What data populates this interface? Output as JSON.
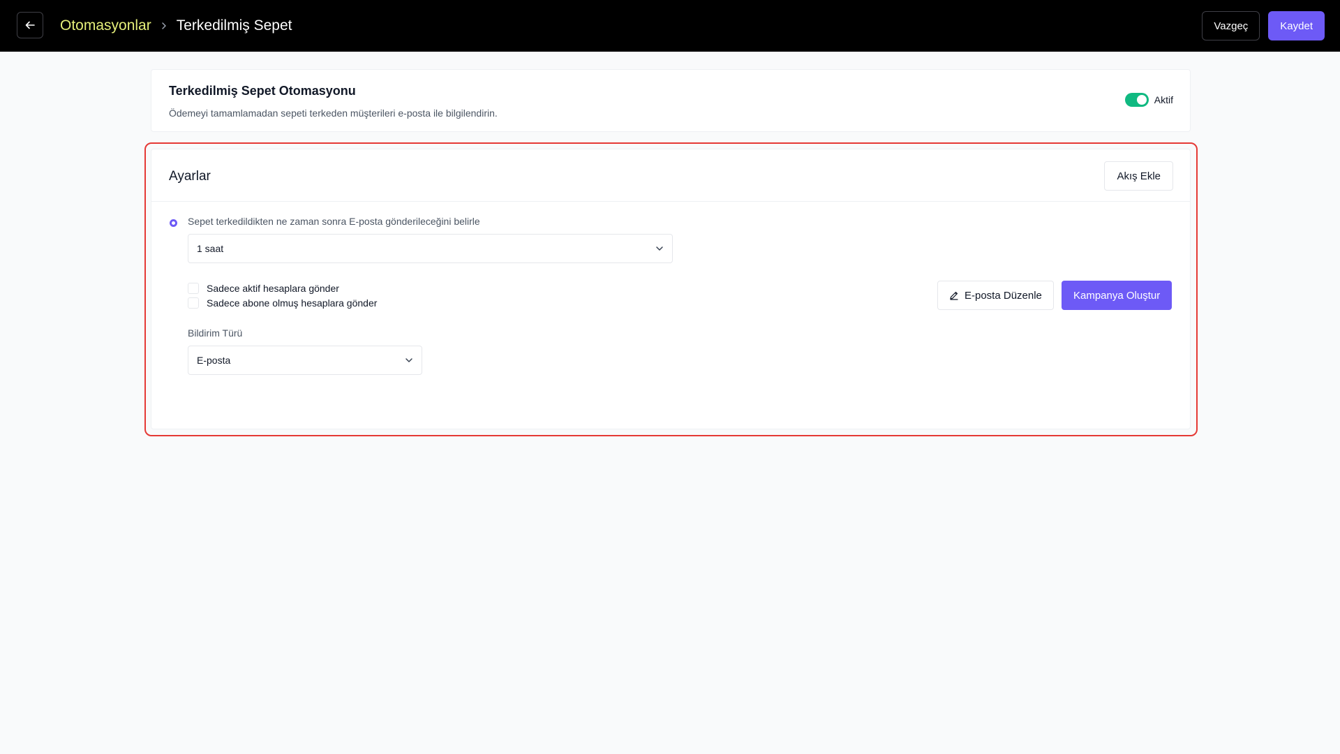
{
  "topbar": {
    "back_icon": "arrow-left-icon",
    "breadcrumb_parent": "Otomasyonlar",
    "breadcrumb_current": "Terkedilmiş Sepet",
    "cancel_label": "Vazgeç",
    "save_label": "Kaydet"
  },
  "header": {
    "title": "Terkedilmiş Sepet Otomasyonu",
    "description": "Ödemeyi tamamlamadan sepeti terkeden müşterileri e-posta ile bilgilendirin.",
    "status_label": "Aktif",
    "status_enabled": true
  },
  "settings": {
    "title": "Ayarlar",
    "add_flow_label": "Akış Ekle",
    "timing_label": "Sepet terkedildikten ne zaman sonra E-posta gönderileceğini belirle",
    "timing_value": "1 saat",
    "checkbox_active_label": "Sadece aktif hesaplara gönder",
    "checkbox_subscribed_label": "Sadece abone olmuş hesaplara gönder",
    "notification_type_label": "Bildirim Türü",
    "notification_type_value": "E-posta",
    "edit_email_label": "E-posta Düzenle",
    "create_campaign_label": "Kampanya Oluştur"
  },
  "colors": {
    "accent": "#6d5af6",
    "toggle_on": "#10b981",
    "breadcrumb_link": "#e6f07a",
    "highlight": "#e53935"
  }
}
